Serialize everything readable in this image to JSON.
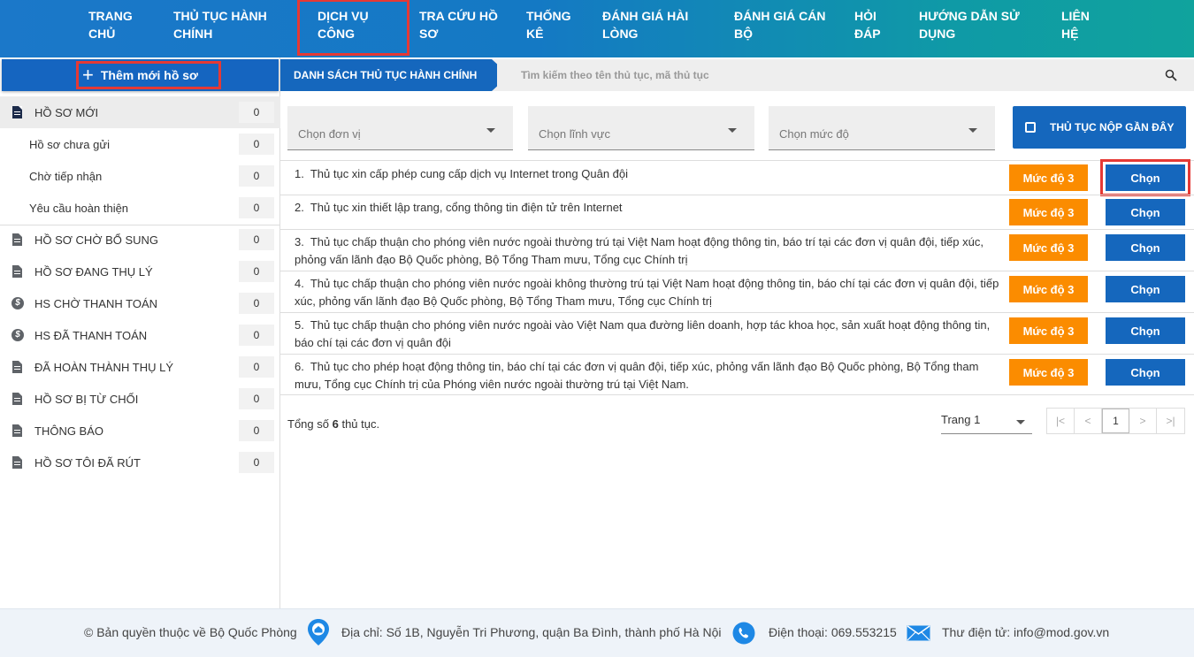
{
  "nav": {
    "items": [
      {
        "label": "TRANG CHỦ"
      },
      {
        "label": "THỦ TỤC HÀNH CHÍNH"
      },
      {
        "label": "DỊCH VỤ CÔNG"
      },
      {
        "label": "TRA CỨU HỒ SƠ"
      },
      {
        "label": "THỐNG KÊ"
      },
      {
        "label": "ĐÁNH GIÁ HÀI LÒNG"
      },
      {
        "label": "ĐÁNH GIÁ CÁN BỘ"
      },
      {
        "label": "HỎI ĐÁP"
      },
      {
        "label": "HƯỚNG DẪN SỬ DỤNG"
      },
      {
        "label": "LIÊN HỆ"
      }
    ],
    "active": "DỊCH VỤ CÔNG"
  },
  "sidebar": {
    "add_label": "Thêm mới hồ sơ",
    "items": [
      {
        "label": "HỒ SƠ MỚI",
        "count": "0",
        "icon": "document-icon"
      },
      {
        "label": "Hồ sơ chưa gửi",
        "count": "0"
      },
      {
        "label": "Chờ tiếp nhận",
        "count": "0"
      },
      {
        "label": "Yêu cầu hoàn thiện",
        "count": "0"
      },
      {
        "label": "HỒ SƠ CHỜ BỔ SUNG",
        "count": "0",
        "icon": "document-icon"
      },
      {
        "label": "HỒ SƠ ĐANG THỤ LÝ",
        "count": "0",
        "icon": "document-icon"
      },
      {
        "label": "HS CHỜ THANH TOÁN",
        "count": "0",
        "icon": "dollar-icon"
      },
      {
        "label": "HS ĐÃ THANH TOÁN",
        "count": "0",
        "icon": "dollar-icon"
      },
      {
        "label": "ĐÃ HOÀN THÀNH THỤ LÝ",
        "count": "0",
        "icon": "document-icon"
      },
      {
        "label": "HỒ SƠ BỊ TỪ CHỐI",
        "count": "0",
        "icon": "document-icon"
      },
      {
        "label": "THÔNG BÁO",
        "count": "0",
        "icon": "document-icon"
      },
      {
        "label": "HỒ SƠ TÔI ĐÃ RÚT",
        "count": "0",
        "icon": "document-icon"
      }
    ]
  },
  "main": {
    "breadcrumb": "DANH SÁCH THỦ TỤC HÀNH CHÍNH",
    "search_placeholder": "Tìm kiếm theo tên thủ tục, mã thủ tục",
    "filters": {
      "unit": "Chọn đơn vị",
      "field": "Chọn lĩnh vực",
      "level": "Chọn mức độ"
    },
    "recent_label": "THỦ TỤC NỘP GẦN ĐÂY",
    "procedures": [
      {
        "num": "1.",
        "text": "Thủ tục xin cấp phép cung cấp dịch vụ Internet trong Quân đội",
        "level": "Mức độ 3",
        "action": "Chọn"
      },
      {
        "num": "2.",
        "text": "Thủ tục xin thiết lập trang, cổng thông tin điện tử trên Internet",
        "level": "Mức độ 3",
        "action": "Chọn"
      },
      {
        "num": "3.",
        "text": "Thủ tục chấp thuận cho phóng viên nước ngoài thường trú tại Việt Nam hoạt động thông tin, báo trí tại các đơn vị quân đội, tiếp xúc, phỏng vấn lãnh đạo Bộ Quốc phòng, Bộ Tổng Tham mưu, Tổng cục Chính trị",
        "level": "Mức độ 3",
        "action": "Chọn"
      },
      {
        "num": "4.",
        "text": "Thủ tục chấp thuận cho phóng viên nước ngoài không thường trú tại Việt Nam hoạt động thông tin, báo chí tại các đơn vị quân đội, tiếp xúc, phỏng vấn lãnh đạo Bộ Quốc phòng, Bộ Tổng Tham mưu, Tổng cục Chính trị",
        "level": "Mức độ 3",
        "action": "Chọn"
      },
      {
        "num": "5.",
        "text": "Thủ tục chấp thuận cho phóng viên nước ngoài vào Việt Nam qua đường liên doanh, hợp tác khoa học, sản xuất hoạt động thông tin, báo chí tại các đơn vị quân đội",
        "level": "Mức độ 3",
        "action": "Chọn"
      },
      {
        "num": "6.",
        "text": "Thủ tục cho phép hoạt động thông tin, báo chí tại các đơn vị quân đội, tiếp xúc, phỏng vấn lãnh đạo Bộ Quốc phòng, Bộ Tổng tham mưu, Tổng cục Chính trị của Phóng viên nước ngoài thường trú tại Việt Nam.",
        "level": "Mức độ 3",
        "action": "Chọn"
      }
    ],
    "total_prefix": "Tổng số",
    "total_count": "6",
    "total_suffix": "thủ tục.",
    "page_select": "Trang 1",
    "pager": {
      "first": "|<",
      "prev": "<",
      "current": "1",
      "next": ">",
      "last": ">|"
    }
  },
  "footer": {
    "copyright": "© Bản quyền thuộc về Bộ Quốc Phòng",
    "address": "Địa chỉ: Số 1B, Nguyễn Tri Phương, quận Ba Đình, thành phố Hà Nội",
    "phone": "Điện thoại: 069.553215",
    "email": "Thư điện tử: info@mod.gov.vn"
  },
  "colors": {
    "primary": "#1567bd",
    "accent_orange": "#fb8c00",
    "highlight_red": "#e53935"
  }
}
